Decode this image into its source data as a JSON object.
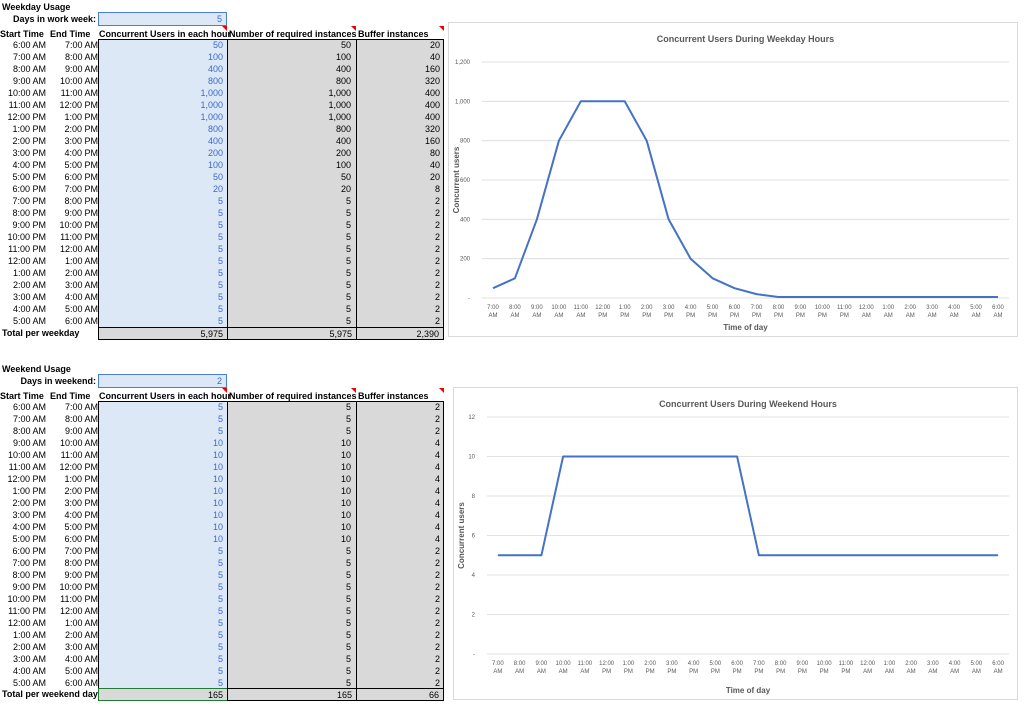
{
  "weekday": {
    "title": "Weekday Usage",
    "days_label": "Days in work week:",
    "days_value": "5",
    "headers": {
      "start": "Start Time",
      "end": "End Time",
      "users": "Concurrent Users in each hour",
      "required": "Number of required instances",
      "buffer": "Buffer instances"
    },
    "rows": [
      {
        "start": "6:00 AM",
        "end": "7:00 AM",
        "users": "50",
        "required": "50",
        "buffer": "20"
      },
      {
        "start": "7:00 AM",
        "end": "8:00 AM",
        "users": "100",
        "required": "100",
        "buffer": "40"
      },
      {
        "start": "8:00 AM",
        "end": "9:00 AM",
        "users": "400",
        "required": "400",
        "buffer": "160"
      },
      {
        "start": "9:00 AM",
        "end": "10:00 AM",
        "users": "800",
        "required": "800",
        "buffer": "320"
      },
      {
        "start": "10:00 AM",
        "end": "11:00 AM",
        "users": "1,000",
        "required": "1,000",
        "buffer": "400"
      },
      {
        "start": "11:00 AM",
        "end": "12:00 PM",
        "users": "1,000",
        "required": "1,000",
        "buffer": "400"
      },
      {
        "start": "12:00 PM",
        "end": "1:00 PM",
        "users": "1,000",
        "required": "1,000",
        "buffer": "400"
      },
      {
        "start": "1:00 PM",
        "end": "2:00 PM",
        "users": "800",
        "required": "800",
        "buffer": "320"
      },
      {
        "start": "2:00 PM",
        "end": "3:00 PM",
        "users": "400",
        "required": "400",
        "buffer": "160"
      },
      {
        "start": "3:00 PM",
        "end": "4:00 PM",
        "users": "200",
        "required": "200",
        "buffer": "80"
      },
      {
        "start": "4:00 PM",
        "end": "5:00 PM",
        "users": "100",
        "required": "100",
        "buffer": "40"
      },
      {
        "start": "5:00 PM",
        "end": "6:00 PM",
        "users": "50",
        "required": "50",
        "buffer": "20"
      },
      {
        "start": "6:00 PM",
        "end": "7:00 PM",
        "users": "20",
        "required": "20",
        "buffer": "8"
      },
      {
        "start": "7:00 PM",
        "end": "8:00 PM",
        "users": "5",
        "required": "5",
        "buffer": "2"
      },
      {
        "start": "8:00 PM",
        "end": "9:00 PM",
        "users": "5",
        "required": "5",
        "buffer": "2"
      },
      {
        "start": "9:00 PM",
        "end": "10:00 PM",
        "users": "5",
        "required": "5",
        "buffer": "2"
      },
      {
        "start": "10:00 PM",
        "end": "11:00 PM",
        "users": "5",
        "required": "5",
        "buffer": "2"
      },
      {
        "start": "11:00 PM",
        "end": "12:00 AM",
        "users": "5",
        "required": "5",
        "buffer": "2"
      },
      {
        "start": "12:00 AM",
        "end": "1:00 AM",
        "users": "5",
        "required": "5",
        "buffer": "2"
      },
      {
        "start": "1:00 AM",
        "end": "2:00 AM",
        "users": "5",
        "required": "5",
        "buffer": "2"
      },
      {
        "start": "2:00 AM",
        "end": "3:00 AM",
        "users": "5",
        "required": "5",
        "buffer": "2"
      },
      {
        "start": "3:00 AM",
        "end": "4:00 AM",
        "users": "5",
        "required": "5",
        "buffer": "2"
      },
      {
        "start": "4:00 AM",
        "end": "5:00 AM",
        "users": "5",
        "required": "5",
        "buffer": "2"
      },
      {
        "start": "5:00 AM",
        "end": "6:00 AM",
        "users": "5",
        "required": "5",
        "buffer": "2"
      }
    ],
    "total_label": "Total per weekday",
    "total_users": "5,975",
    "total_required": "5,975",
    "total_buffer": "2,390"
  },
  "weekend": {
    "title": "Weekend Usage",
    "days_label": "Days in weekend:",
    "days_value": "2",
    "headers": {
      "start": "Start Time",
      "end": "End Time",
      "users": "Concurrent Users in each hour",
      "required": "Number of required instances",
      "buffer": "Buffer instances"
    },
    "rows": [
      {
        "start": "6:00 AM",
        "end": "7:00 AM",
        "users": "5",
        "required": "5",
        "buffer": "2"
      },
      {
        "start": "7:00 AM",
        "end": "8:00 AM",
        "users": "5",
        "required": "5",
        "buffer": "2"
      },
      {
        "start": "8:00 AM",
        "end": "9:00 AM",
        "users": "5",
        "required": "5",
        "buffer": "2"
      },
      {
        "start": "9:00 AM",
        "end": "10:00 AM",
        "users": "10",
        "required": "10",
        "buffer": "4"
      },
      {
        "start": "10:00 AM",
        "end": "11:00 AM",
        "users": "10",
        "required": "10",
        "buffer": "4"
      },
      {
        "start": "11:00 AM",
        "end": "12:00 PM",
        "users": "10",
        "required": "10",
        "buffer": "4"
      },
      {
        "start": "12:00 PM",
        "end": "1:00 PM",
        "users": "10",
        "required": "10",
        "buffer": "4"
      },
      {
        "start": "1:00 PM",
        "end": "2:00 PM",
        "users": "10",
        "required": "10",
        "buffer": "4"
      },
      {
        "start": "2:00 PM",
        "end": "3:00 PM",
        "users": "10",
        "required": "10",
        "buffer": "4"
      },
      {
        "start": "3:00 PM",
        "end": "4:00 PM",
        "users": "10",
        "required": "10",
        "buffer": "4"
      },
      {
        "start": "4:00 PM",
        "end": "5:00 PM",
        "users": "10",
        "required": "10",
        "buffer": "4"
      },
      {
        "start": "5:00 PM",
        "end": "6:00 PM",
        "users": "10",
        "required": "10",
        "buffer": "4"
      },
      {
        "start": "6:00 PM",
        "end": "7:00 PM",
        "users": "5",
        "required": "5",
        "buffer": "2"
      },
      {
        "start": "7:00 PM",
        "end": "8:00 PM",
        "users": "5",
        "required": "5",
        "buffer": "2"
      },
      {
        "start": "8:00 PM",
        "end": "9:00 PM",
        "users": "5",
        "required": "5",
        "buffer": "2"
      },
      {
        "start": "9:00 PM",
        "end": "10:00 PM",
        "users": "5",
        "required": "5",
        "buffer": "2"
      },
      {
        "start": "10:00 PM",
        "end": "11:00 PM",
        "users": "5",
        "required": "5",
        "buffer": "2"
      },
      {
        "start": "11:00 PM",
        "end": "12:00 AM",
        "users": "5",
        "required": "5",
        "buffer": "2"
      },
      {
        "start": "12:00 AM",
        "end": "1:00 AM",
        "users": "5",
        "required": "5",
        "buffer": "2"
      },
      {
        "start": "1:00 AM",
        "end": "2:00 AM",
        "users": "5",
        "required": "5",
        "buffer": "2"
      },
      {
        "start": "2:00 AM",
        "end": "3:00 AM",
        "users": "5",
        "required": "5",
        "buffer": "2"
      },
      {
        "start": "3:00 AM",
        "end": "4:00 AM",
        "users": "5",
        "required": "5",
        "buffer": "2"
      },
      {
        "start": "4:00 AM",
        "end": "5:00 AM",
        "users": "5",
        "required": "5",
        "buffer": "2"
      },
      {
        "start": "5:00 AM",
        "end": "6:00 AM",
        "users": "5",
        "required": "5",
        "buffer": "2"
      }
    ],
    "total_label": "Total per weekend day",
    "total_users": "165",
    "total_required": "165",
    "total_buffer": "66"
  },
  "chart_data": [
    {
      "type": "line",
      "title": "Concurrent Users During Weekday Hours",
      "xlabel": "Time of day",
      "ylabel": "Concurrent users",
      "ylim": [
        0,
        1200
      ],
      "yticks": [
        "-",
        "200",
        "400",
        "600",
        "800",
        "1,000",
        "1,200"
      ],
      "grid": true,
      "x_top": [
        "7:00",
        "8:00",
        "9:00",
        "10:00",
        "11:00",
        "12:00",
        "1:00",
        "2:00",
        "3:00",
        "4:00",
        "5:00",
        "6:00",
        "7:00",
        "8:00",
        "9:00",
        "10:00",
        "11:00",
        "12:00",
        "1:00",
        "2:00",
        "3:00",
        "4:00",
        "5:00",
        "6:00"
      ],
      "x_bottom": [
        "AM",
        "AM",
        "AM",
        "AM",
        "AM",
        "PM",
        "PM",
        "PM",
        "PM",
        "PM",
        "PM",
        "PM",
        "PM",
        "PM",
        "PM",
        "PM",
        "PM",
        "AM",
        "AM",
        "AM",
        "AM",
        "AM",
        "AM",
        "AM"
      ],
      "values": [
        50,
        100,
        400,
        800,
        1000,
        1000,
        1000,
        800,
        400,
        200,
        100,
        50,
        20,
        5,
        5,
        5,
        5,
        5,
        5,
        5,
        5,
        5,
        5,
        5
      ],
      "color": "#4472c4"
    },
    {
      "type": "line",
      "title": "Concurrent Users During Weekend Hours",
      "xlabel": "Time of day",
      "ylabel": "Concurrent users",
      "ylim": [
        0,
        12
      ],
      "yticks": [
        "-",
        "2",
        "4",
        "6",
        "8",
        "10",
        "12"
      ],
      "grid": true,
      "x_top": [
        "7:00",
        "8:00",
        "9:00",
        "10:00",
        "11:00",
        "12:00",
        "1:00",
        "2:00",
        "3:00",
        "4:00",
        "5:00",
        "6:00",
        "7:00",
        "8:00",
        "9:00",
        "10:00",
        "11:00",
        "12:00",
        "1:00",
        "2:00",
        "3:00",
        "4:00",
        "5:00",
        "6:00"
      ],
      "x_bottom": [
        "AM",
        "AM",
        "AM",
        "AM",
        "AM",
        "PM",
        "PM",
        "PM",
        "PM",
        "PM",
        "PM",
        "PM",
        "PM",
        "PM",
        "PM",
        "PM",
        "PM",
        "AM",
        "AM",
        "AM",
        "AM",
        "AM",
        "AM",
        "AM"
      ],
      "values": [
        5,
        5,
        5,
        10,
        10,
        10,
        10,
        10,
        10,
        10,
        10,
        10,
        5,
        5,
        5,
        5,
        5,
        5,
        5,
        5,
        5,
        5,
        5,
        5
      ],
      "color": "#4472c4"
    }
  ]
}
